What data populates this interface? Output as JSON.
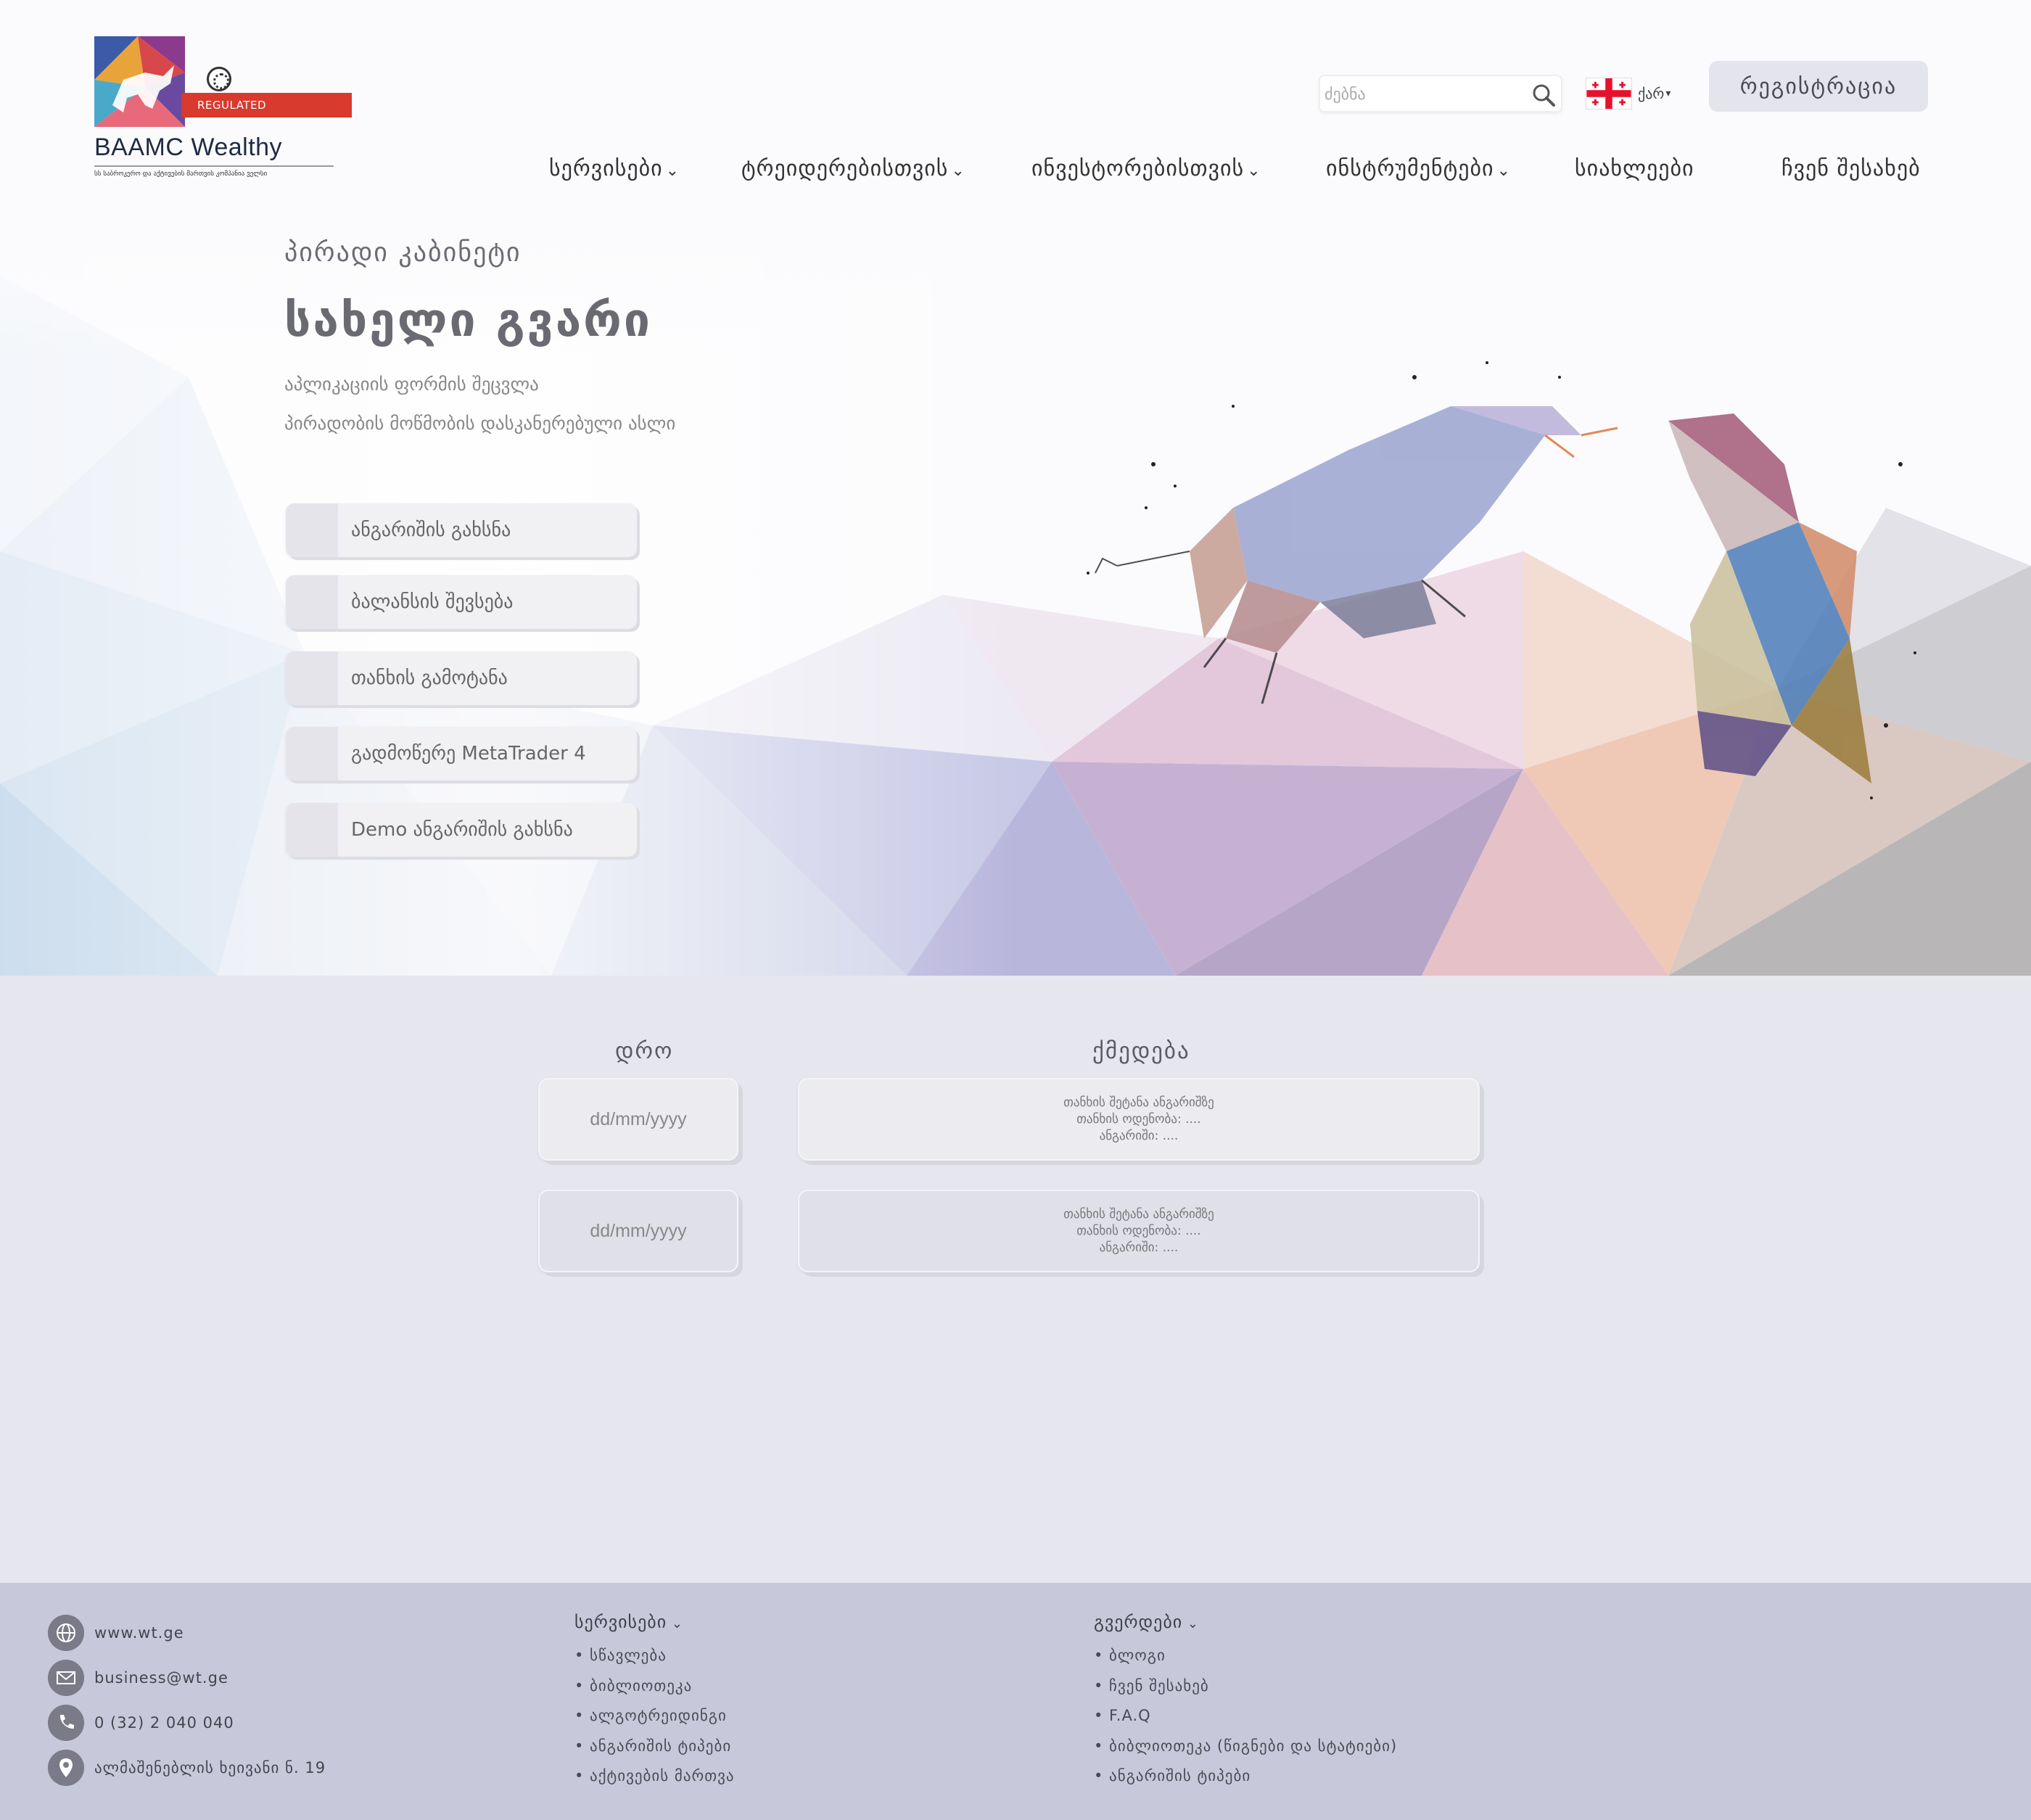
{
  "header": {
    "logo": {
      "title": "BAAMC Wealthy",
      "badge": "REGULATED",
      "subtitle": "სს საბროკერო და აქტივების მართვის კომპანია ველსი"
    },
    "search": {
      "placeholder": "ძებნა"
    },
    "language": {
      "label": "ქარ"
    },
    "register_label": "რეგისტრაცია"
  },
  "nav": {
    "services": "სერვისები",
    "traders": "ტრეიდერებისთვის",
    "investors": "ინვესტორებისთვის",
    "instruments": "ინსტრუმენტები",
    "news": "სიახლეები",
    "about": "ჩვენ შესახებ"
  },
  "hero": {
    "cabinet_label": "პირადი კაბინეტი",
    "user_name": "სახელი გვარი",
    "links": [
      "აპლიკაციის ფორმის შეცვლა",
      "პირადობის მოწმობის დასკანერებული ასლი"
    ],
    "actions": [
      "ანგარიშის გახსნა",
      "ბალანსის შევსება",
      "თანხის გამოტანა",
      "გადმოწერე MetaTrader 4",
      "Demo ანგარიშის გახსნა"
    ]
  },
  "history": {
    "col_time": "დრო",
    "col_action": "ქმედება",
    "rows": [
      {
        "date": "dd/mm/yyyy",
        "line1": "თანხის შეტანა ანგარიშზე",
        "line2": "თანხის ოდენობა: ....",
        "line3": "ანგარიში: ...."
      },
      {
        "date": "dd/mm/yyyy",
        "line1": "თანხის შეტანა ანგარიშზე",
        "line2": "თანხის ოდენობა: ....",
        "line3": "ანგარიში: ...."
      }
    ]
  },
  "footer": {
    "contacts": {
      "website": "www.wt.ge",
      "email": "business@wt.ge",
      "phone": "0 (32) 2 040 040",
      "address": "ალმაშენებლის ხეივანი ნ. 19"
    },
    "services": {
      "title": "სერვისები",
      "items": [
        "• სწავლება",
        "• ბიბლიოთეკა",
        "• ალგოტრეიდინგი",
        "• ანგარიშის ტიპები",
        "• აქტივების მართვა"
      ]
    },
    "pages": {
      "title": "გვერდები",
      "items": [
        "• ბლოგი",
        "• ჩვენ შესახებ",
        "• F.A.Q",
        "• ბიბლიოთეკა (წიგნები და სტატიები)",
        "• ანგარიშის ტიპები"
      ]
    }
  },
  "colors": {
    "page_bg": "#e6e6ef",
    "footer_bg": "#c8c8db",
    "register_bg": "#e4e4ec",
    "logo_ribbon": "#d83a2e"
  }
}
